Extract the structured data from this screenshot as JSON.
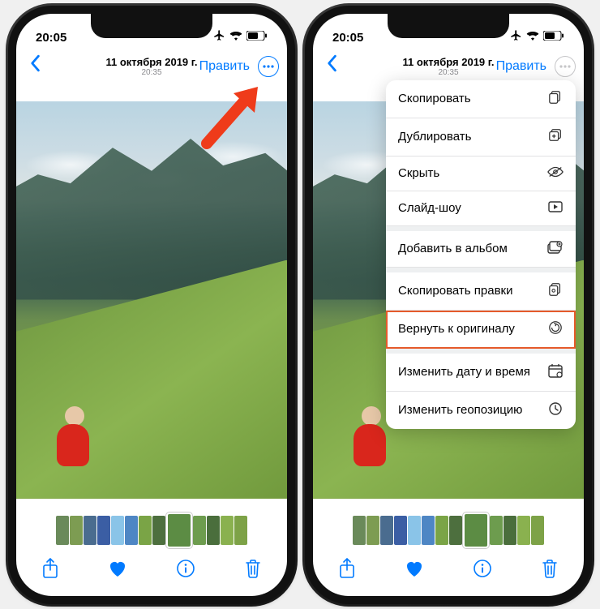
{
  "status": {
    "time": "20:05"
  },
  "nav": {
    "title": "11 октября 2019 г.",
    "subtitle": "20:35",
    "edit": "Править"
  },
  "menu": {
    "copy": "Скопировать",
    "duplicate": "Дублировать",
    "hide": "Скрыть",
    "slideshow": "Слайд-шоу",
    "add_album": "Добавить в альбом",
    "copy_edits": "Скопировать правки",
    "revert": "Вернуть к оригиналу",
    "adjust_date": "Изменить дату и время",
    "adjust_loc": "Изменить геопозицию"
  },
  "thumb_colors": [
    "#6a8a5a",
    "#7d9c52",
    "#4a6c8f",
    "#3b5ea4",
    "#8ac4e8",
    "#4e86c4",
    "#7aa446",
    "#4d6f3e",
    "#5c8c44",
    "#6d9c4e",
    "#4a6e3c",
    "#8ab14f",
    "#7da247"
  ]
}
